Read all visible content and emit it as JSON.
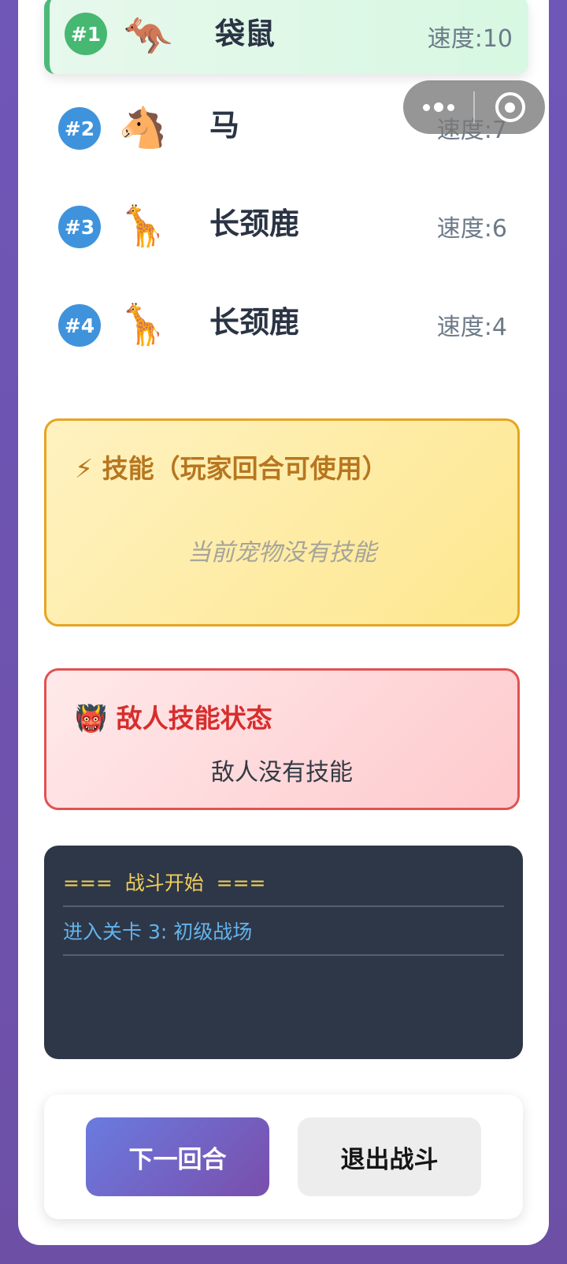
{
  "turn_order": [
    {
      "rank": "#1",
      "emoji": "🦘",
      "name": "袋鼠",
      "speed": "速度:10",
      "active": true
    },
    {
      "rank": "#2",
      "emoji": "🐴",
      "name": "马",
      "speed": "速度:7",
      "active": false
    },
    {
      "rank": "#3",
      "emoji": "🦒",
      "name": "长颈鹿",
      "speed": "速度:6",
      "active": false
    },
    {
      "rank": "#4",
      "emoji": "🦒",
      "name": "长颈鹿",
      "speed": "速度:4",
      "active": false
    }
  ],
  "capsule": {
    "more_icon": "more-dots-icon",
    "close_icon": "target-close-icon"
  },
  "skills_panel": {
    "title": "⚡ 技能（玩家回合可使用）",
    "empty_text": "当前宠物没有技能"
  },
  "enemy_panel": {
    "title": "👹 敌人技能状态",
    "empty_text": "敌人没有技能"
  },
  "battle_log": [
    "===  战斗开始  ===",
    "进入关卡 3: 初级战场"
  ],
  "buttons": {
    "next_turn": "下一回合",
    "exit_battle": "退出战斗"
  },
  "colors": {
    "active_row": "#d7f8e2",
    "active_rank": "#46b872",
    "rank": "#3f93dc",
    "skills_border": "#e7a421",
    "enemy_border": "#e05252",
    "log_bg": "#2e3747",
    "primary_button": "#6a7be0"
  }
}
